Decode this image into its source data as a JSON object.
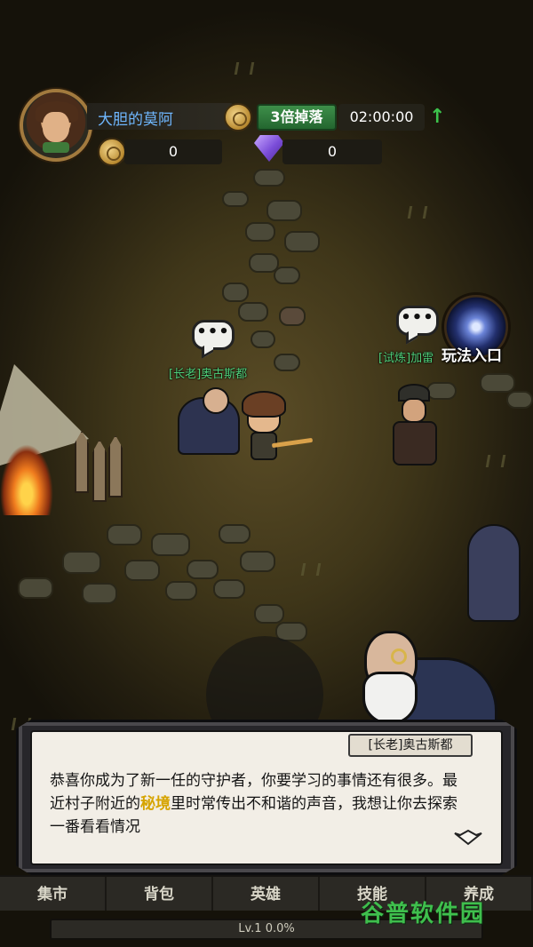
{
  "hud": {
    "player_name": "大胆的莫阿",
    "drop_bonus": "3倍掉落",
    "timer": "02:00:00",
    "gold": "0",
    "gems": "0"
  },
  "world": {
    "elder_label": "[长老]奥古斯都",
    "trial_label": "[试炼]加雷",
    "portal_label": "玩法入口",
    "bubble_text": "•••"
  },
  "dialog": {
    "speaker": "[长老]奥古斯都",
    "text_before": "恭喜你成为了新一任的守护者，你要学习的事情还有很多。最近村子附近的",
    "highlight": "秘境",
    "text_after": "里时常传出不和谐的声音，我想让你去探索一番看看情况"
  },
  "tabs": [
    "集市",
    "背包",
    "英雄",
    "技能",
    "养成"
  ],
  "xp": "Lv.1   0.0%",
  "watermark": "谷普软件园",
  "colors": {
    "name": "#6fb7ff",
    "npc_label": "#4fd07a",
    "highlight": "#d6a400",
    "drop_badge": "#3e8f4a"
  }
}
